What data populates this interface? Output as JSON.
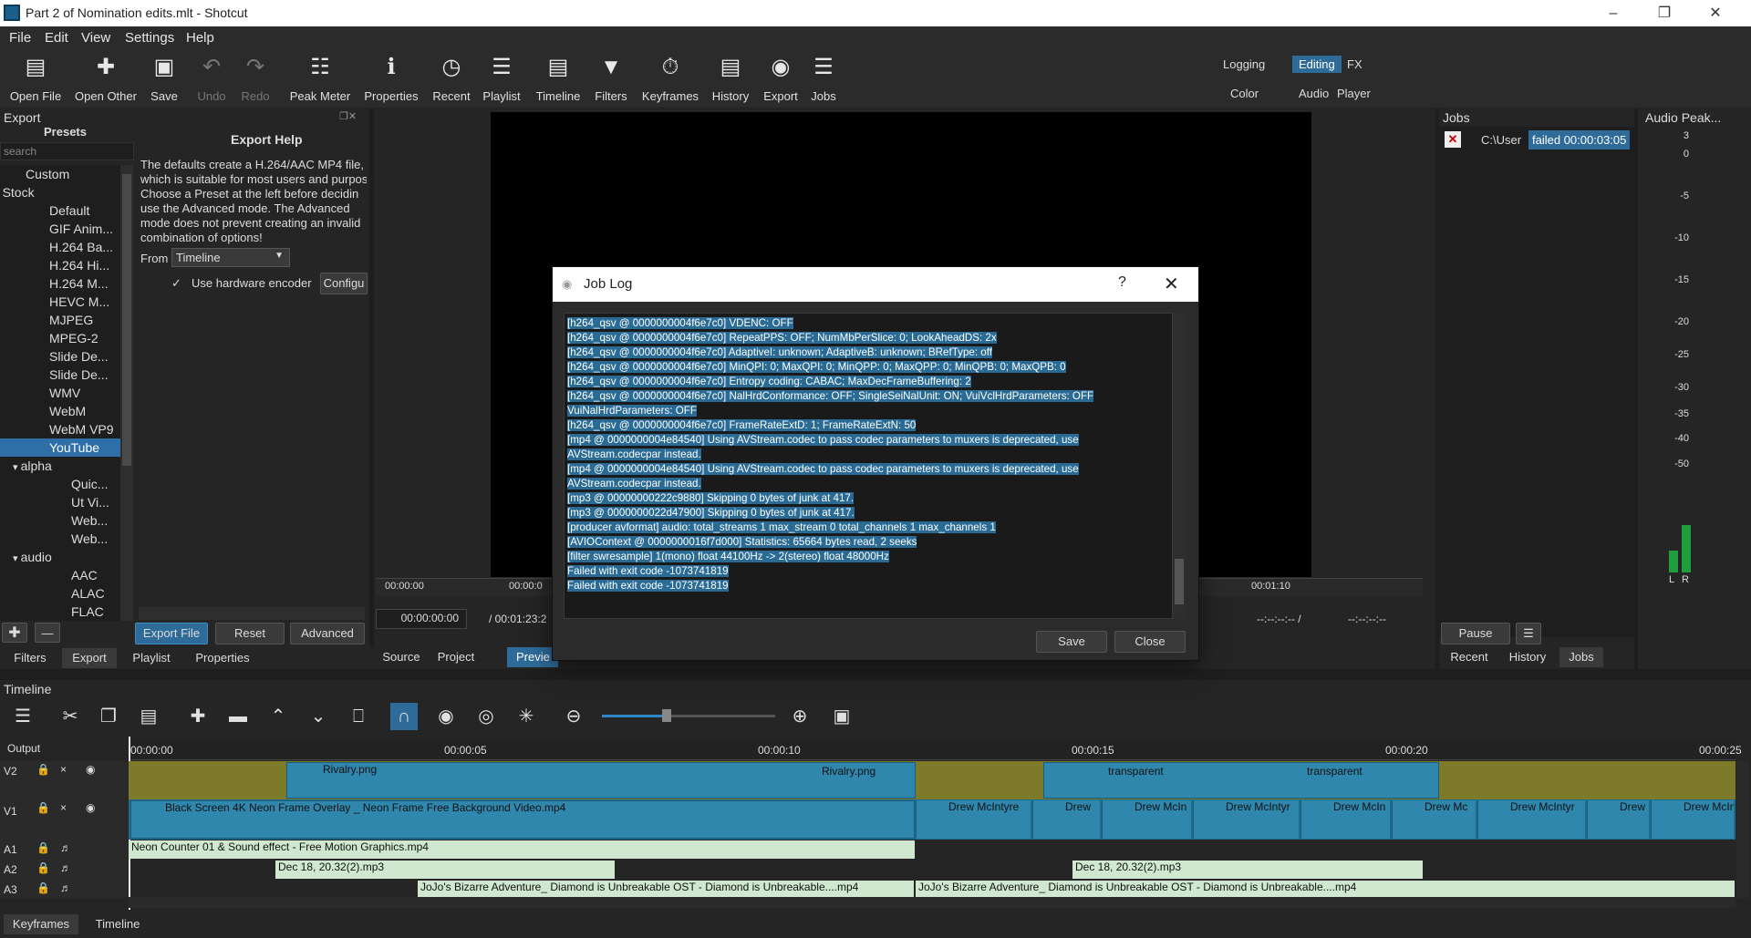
{
  "window": {
    "title": "Part 2 of Nomination edits.mlt - Shotcut"
  },
  "menu": [
    "File",
    "Edit",
    "View",
    "Settings",
    "Help"
  ],
  "toolbar": [
    {
      "label": "Open File",
      "icon": "folder-icon"
    },
    {
      "label": "Open Other",
      "icon": "open-other-icon"
    },
    {
      "label": "Save",
      "icon": "save-icon"
    },
    {
      "label": "Undo",
      "icon": "undo-icon",
      "disabled": true
    },
    {
      "label": "Redo",
      "icon": "redo-icon",
      "disabled": true
    },
    {
      "label": "Peak Meter",
      "icon": "peak-meter-icon"
    },
    {
      "label": "Properties",
      "icon": "info-icon"
    },
    {
      "label": "Recent",
      "icon": "clock-icon"
    },
    {
      "label": "Playlist",
      "icon": "list-icon"
    },
    {
      "label": "Timeline",
      "icon": "timeline-icon"
    },
    {
      "label": "Filters",
      "icon": "filter-icon"
    },
    {
      "label": "Keyframes",
      "icon": "stopwatch-icon"
    },
    {
      "label": "History",
      "icon": "history-icon"
    },
    {
      "label": "Export",
      "icon": "disc-icon"
    },
    {
      "label": "Jobs",
      "icon": "stack-icon"
    }
  ],
  "layouts": {
    "row1": [
      "Logging",
      "Editing",
      "FX"
    ],
    "row2": [
      "Color",
      "Audio",
      "Player"
    ],
    "active": "Editing"
  },
  "export": {
    "panel_title": "Export",
    "presets_title": "Presets",
    "search_placeholder": "search",
    "tree": [
      {
        "label": "Custom",
        "level": 1
      },
      {
        "label": "Stock",
        "level": 0,
        "expander": true
      },
      {
        "label": "Default",
        "level": 2
      },
      {
        "label": "GIF Anim...",
        "level": 2
      },
      {
        "label": "H.264 Ba...",
        "level": 2
      },
      {
        "label": "H.264 Hi...",
        "level": 2
      },
      {
        "label": "H.264 M...",
        "level": 2
      },
      {
        "label": "HEVC M...",
        "level": 2
      },
      {
        "label": "MJPEG",
        "level": 2
      },
      {
        "label": "MPEG-2",
        "level": 2
      },
      {
        "label": "Slide De...",
        "level": 2
      },
      {
        "label": "Slide De...",
        "level": 2
      },
      {
        "label": "WMV",
        "level": 2
      },
      {
        "label": "WebM",
        "level": 2
      },
      {
        "label": "WebM VP9",
        "level": 2
      },
      {
        "label": "YouTube",
        "level": 2,
        "selected": true
      },
      {
        "label": "alpha",
        "level": 1,
        "expander": true
      },
      {
        "label": "Quic...",
        "level": 3
      },
      {
        "label": "Ut Vi...",
        "level": 3
      },
      {
        "label": "Web...",
        "level": 3
      },
      {
        "label": "Web...",
        "level": 3
      },
      {
        "label": "audio",
        "level": 1,
        "expander": true
      },
      {
        "label": "AAC",
        "level": 3
      },
      {
        "label": "ALAC",
        "level": 3
      },
      {
        "label": "FLAC",
        "level": 3
      }
    ],
    "help_title": "Export Help",
    "help_lines": [
      "The defaults create a H.264/AAC MP4 file,",
      "which is suitable for most users and purpos",
      "Choose a Preset at the left before decidin",
      "use the Advanced mode. The Advanced",
      "mode does not prevent creating an invalid",
      "combination of options!"
    ],
    "from_label": "From",
    "from_value": "Timeline",
    "hw_encoder_label": "Use hardware encoder",
    "configure_label": "Configu",
    "export_file": "Export File",
    "reset": "Reset",
    "advanced": "Advanced"
  },
  "left_tabs": [
    "Filters",
    "Export",
    "Playlist",
    "Properties"
  ],
  "player": {
    "ruler_ticks": [
      "00:00:00",
      "00:00:0",
      "00:01:10"
    ],
    "timecode": "00:00:00:00",
    "duration": "/ 00:01:23:2",
    "in_out_a": "--:--:--:-- /",
    "in_out_b": "--:--:--:--",
    "tabs": [
      "Source",
      "Project",
      "Previe"
    ]
  },
  "jobs": {
    "title": "Jobs",
    "item_path": "C:\\User",
    "item_status": "failed 00:00:03:05",
    "pause": "Pause",
    "tabs": [
      "Recent",
      "History",
      "Jobs"
    ]
  },
  "audio_peak": {
    "title": "Audio Peak...",
    "scale": [
      "3",
      "0",
      "-5",
      "-10",
      "-15",
      "-20",
      "-25",
      "-30",
      "-35",
      "-40",
      "-50"
    ],
    "channels": [
      "L",
      "R"
    ]
  },
  "dialog": {
    "title": "Job Log",
    "help": "?",
    "lines": [
      "[h264_qsv @ 0000000004f6e7c0] VDENC: OFF",
      "[h264_qsv @ 0000000004f6e7c0] RepeatPPS: OFF; NumMbPerSlice: 0; LookAheadDS: 2x",
      "[h264_qsv @ 0000000004f6e7c0] AdaptiveI: unknown; AdaptiveB: unknown; BRefType: off",
      "[h264_qsv @ 0000000004f6e7c0] MinQPI: 0; MaxQPI: 0; MinQPP: 0; MaxQPP: 0; MinQPB: 0; MaxQPB: 0",
      "[h264_qsv @ 0000000004f6e7c0] Entropy coding: CABAC; MaxDecFrameBuffering: 2",
      "[h264_qsv @ 0000000004f6e7c0] NalHrdConformance: OFF; SingleSeiNalUnit: ON; VuiVclHrdParameters: OFF",
      "VuiNalHrdParameters: OFF",
      "[h264_qsv @ 0000000004f6e7c0] FrameRateExtD: 1; FrameRateExtN: 50",
      "[mp4 @ 0000000004e84540] Using AVStream.codec to pass codec parameters to muxers is deprecated, use",
      "AVStream.codecpar instead.",
      "[mp4 @ 0000000004e84540] Using AVStream.codec to pass codec parameters to muxers is deprecated, use",
      "AVStream.codecpar instead.",
      "[mp3 @ 00000000222c9880] Skipping 0 bytes of junk at 417.",
      "[mp3 @ 0000000022d47900] Skipping 0 bytes of junk at 417.",
      "[producer avformat] audio: total_streams 1 max_stream 0 total_channels 1 max_channels 1",
      "[AVIOContext @ 0000000016f7d000] Statistics: 65664 bytes read, 2 seeks",
      "[filter swresample] 1(mono) float 44100Hz -> 2(stereo) float 48000Hz",
      "Failed with exit code -1073741819",
      "Failed with exit code -1073741819"
    ],
    "save": "Save",
    "close": "Close"
  },
  "timeline": {
    "title": "Timeline",
    "output_label": "Output",
    "ruler": [
      "00:00:00",
      "00:00:05",
      "00:00:10",
      "00:00:15",
      "00:00:20",
      "00:00:25"
    ],
    "tracks": [
      "V2",
      "V1",
      "A1",
      "A2",
      "A3"
    ],
    "clips": {
      "v2a": "Rivalry.png",
      "v2b": "Rivalry.png",
      "v2c": "transparent",
      "v2d": "transparent",
      "v1a": "Black Screen 4K Neon Frame Overlay _ Neon Frame Free Background Video.mp4",
      "v1b": [
        "Drew McIntyre",
        "Drew",
        "Drew McIn",
        "Drew McIntyr",
        "Drew McIn",
        "Drew Mc",
        "Drew McIntyr",
        "Drew",
        "Drew McIn"
      ],
      "a1": "Neon Counter 01 & Sound effect - Free Motion Graphics.mp4",
      "a2a": "Dec 18, 20.32(2).mp3",
      "a2b": "Dec 18, 20.32(2).mp3",
      "a3a": "JoJo's Bizarre Adventure_ Diamond is Unbreakable OST - Diamond is Unbreakable....mp4",
      "a3b": "JoJo's Bizarre Adventure_ Diamond is Unbreakable OST - Diamond is Unbreakable....mp4"
    }
  },
  "bottom_tabs": [
    "Keyframes",
    "Timeline"
  ],
  "colors": {
    "accent": "#2e6b99",
    "selection": "#2a6b96",
    "video_clip": "#2f87ad",
    "audio_clip": "#cfe8cf",
    "track_fill": "#7d7b2a"
  }
}
